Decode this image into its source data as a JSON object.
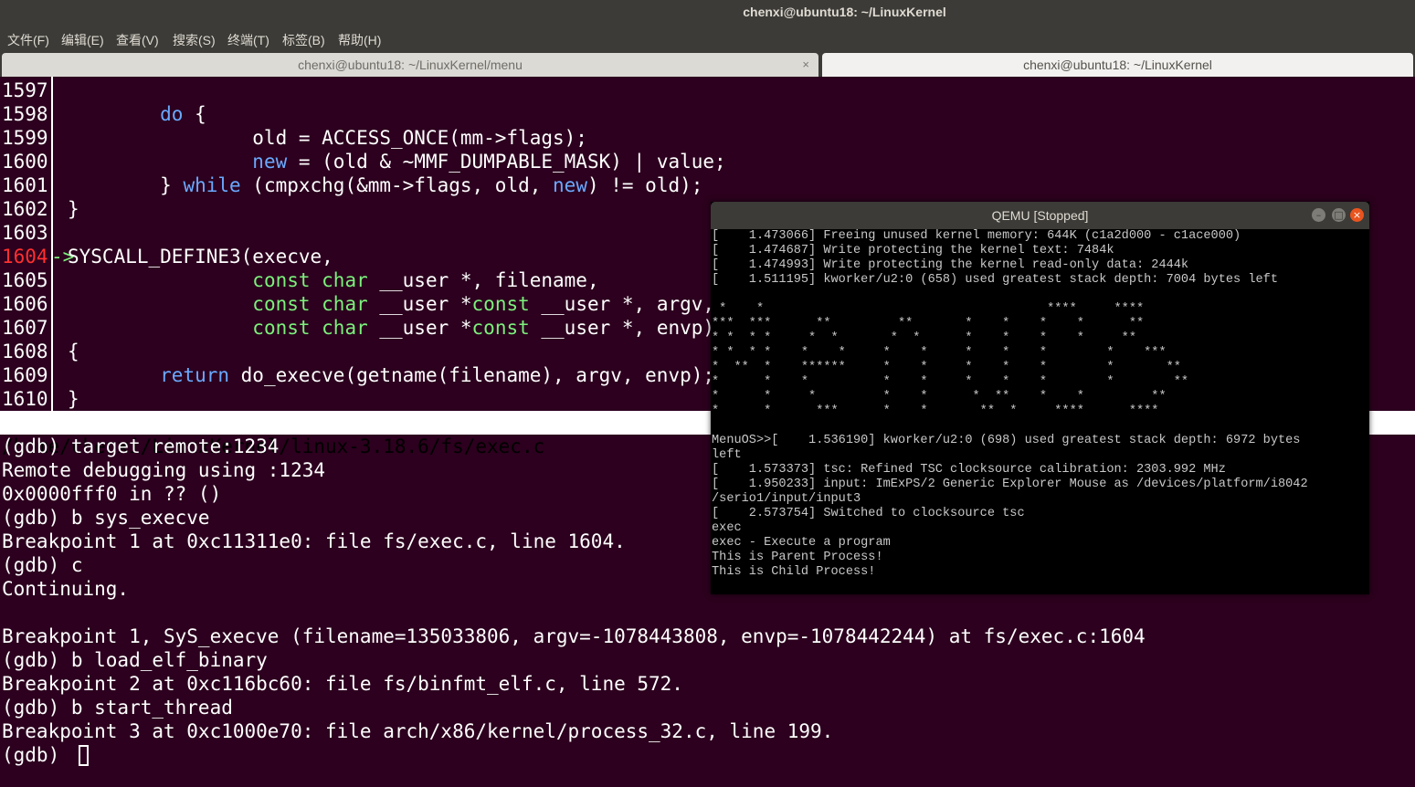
{
  "window": {
    "title": "chenxi@ubuntu18: ~/LinuxKernel"
  },
  "menu": [
    "文件(F)",
    "编辑(E)",
    "查看(V)",
    "搜索(S)",
    "终端(T)",
    "标签(B)",
    "帮助(H)"
  ],
  "tabs": [
    {
      "label": "chenxi@ubuntu18: ~/LinuxKernel/menu",
      "close": "×"
    },
    {
      "label": "chenxi@ubuntu18: ~/LinuxKernel"
    }
  ],
  "source": {
    "current_line_marker": "->",
    "lines": [
      {
        "n": "1597",
        "parts": []
      },
      {
        "n": "1598",
        "parts": [
          [
            "",
            "        "
          ],
          [
            "kw",
            "do"
          ],
          [
            "",
            " {"
          ]
        ]
      },
      {
        "n": "1599",
        "parts": [
          [
            "",
            "                old = ACCESS_ONCE(mm->flags);"
          ]
        ]
      },
      {
        "n": "1600",
        "parts": [
          [
            "",
            "                "
          ],
          [
            "kw",
            "new"
          ],
          [
            "",
            " = (old & ~MMF_DUMPABLE_MASK) | value;"
          ]
        ]
      },
      {
        "n": "1601",
        "parts": [
          [
            "",
            "        } "
          ],
          [
            "kw",
            "while"
          ],
          [
            "",
            " (cmpxchg(&mm->flags, old, "
          ],
          [
            "kw",
            "new"
          ],
          [
            "",
            ") != old);"
          ]
        ]
      },
      {
        "n": "1602",
        "parts": [
          [
            "",
            "}"
          ]
        ]
      },
      {
        "n": "1603",
        "parts": []
      },
      {
        "n": "1604",
        "current": true,
        "parts": [
          [
            "",
            "SYSCALL_DEFINE3(execve,"
          ]
        ]
      },
      {
        "n": "1605",
        "parts": [
          [
            "",
            "                "
          ],
          [
            "ty",
            "const char"
          ],
          [
            "",
            " __user *, filename,"
          ]
        ]
      },
      {
        "n": "1606",
        "parts": [
          [
            "",
            "                "
          ],
          [
            "ty",
            "const char"
          ],
          [
            "",
            " __user *"
          ],
          [
            "ty",
            "const"
          ],
          [
            "",
            " __user *, argv,"
          ]
        ]
      },
      {
        "n": "1607",
        "parts": [
          [
            "",
            "                "
          ],
          [
            "ty",
            "const char"
          ],
          [
            "",
            " __user *"
          ],
          [
            "ty",
            "const"
          ],
          [
            "",
            " __user *, envp)"
          ]
        ]
      },
      {
        "n": "1608",
        "parts": [
          [
            "",
            "{"
          ]
        ]
      },
      {
        "n": "1609",
        "parts": [
          [
            "",
            "        "
          ],
          [
            "kw",
            "return"
          ],
          [
            "",
            " do_execve(getname(filename), argv, envp);"
          ]
        ]
      },
      {
        "n": "1610",
        "parts": [
          [
            "",
            "}"
          ]
        ]
      }
    ]
  },
  "status_path": "/home/chenxi/LinuxKernel/linux-3.18.6/fs/exec.c",
  "gdb": [
    "(gdb) target remote:1234",
    "Remote debugging using :1234",
    "0x0000fff0 in ?? ()",
    "(gdb) b sys_execve",
    "Breakpoint 1 at 0xc11311e0: file fs/exec.c, line 1604.",
    "(gdb) c",
    "Continuing.",
    "",
    "Breakpoint 1, SyS_execve (filename=135033806, argv=-1078443808, envp=-1078442244) at fs/exec.c:1604",
    "(gdb) b load_elf_binary",
    "Breakpoint 2 at 0xc116bc60: file fs/binfmt_elf.c, line 572.",
    "(gdb) b start_thread",
    "Breakpoint 3 at 0xc1000e70: file arch/x86/kernel/process_32.c, line 199.",
    "(gdb) "
  ],
  "qemu": {
    "title": "QEMU [Stopped]",
    "lines": [
      "[    1.473066] Freeing unused kernel memory: 644K (c1a2d000 - c1ace000)",
      "[    1.474687] Write protecting the kernel text: 7484k",
      "[    1.474993] Write protecting the kernel read-only data: 2444k",
      "[    1.511195] kworker/u2:0 (658) used greatest stack depth: 7004 bytes left",
      "",
      " *    *                                      ****     ****",
      "***  ***      **         **       *    *    *    *      **",
      "* *  * *     *  *       *  *      *    *    *    *     **",
      "* *  * *    *    *     *    *     *    *    *        *    ***",
      "*  **  *    ******     *    *     *    *    *        *       **",
      "*      *    *          *    *     *    *    *        *        **",
      "*      *     *         *    *      *  **    *    *         **",
      "*      *      ***      *    *       **  *     ****      ****",
      "",
      "MenuOS>>[    1.536190] kworker/u2:0 (698) used greatest stack depth: 6972 bytes",
      "left",
      "[    1.573373] tsc: Refined TSC clocksource calibration: 2303.992 MHz",
      "[    1.950233] input: ImExPS/2 Generic Explorer Mouse as /devices/platform/i8042",
      "/serio1/input/input3",
      "[    2.573754] Switched to clocksource tsc",
      "exec",
      "exec - Execute a program",
      "This is Parent Process!",
      "This is Child Process!"
    ]
  }
}
